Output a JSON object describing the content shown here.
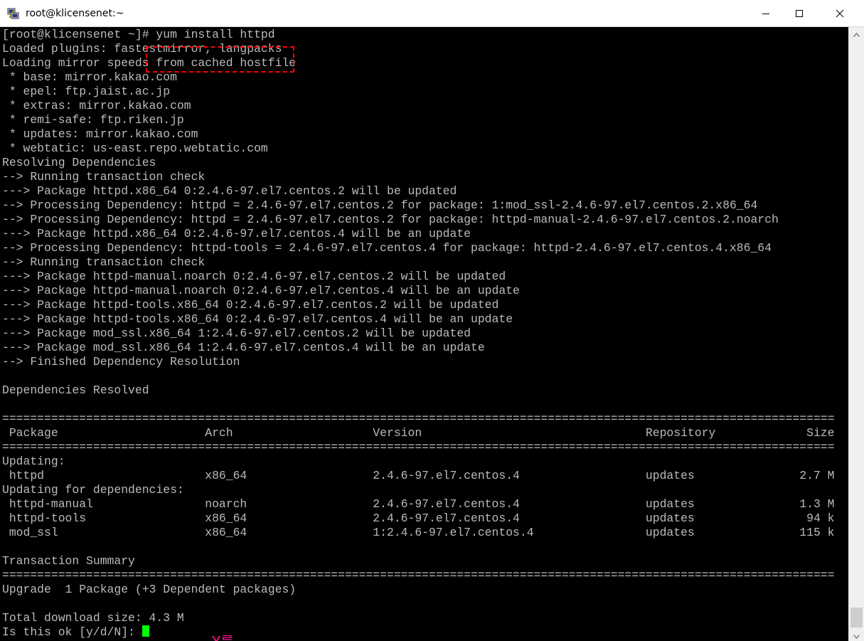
{
  "window": {
    "title": "root@klicensenet:~",
    "app_icon": "putty-icon",
    "controls": {
      "minimize": "minimize-icon",
      "maximize": "maximize-icon",
      "close": "close-icon"
    }
  },
  "terminal": {
    "foreground": "#bbbbbb",
    "background": "#000000",
    "cursor_color": "#00ff00",
    "lines": [
      "[root@klicensenet ~]# yum install httpd",
      "Loaded plugins: fastestmirror, langpacks",
      "Loading mirror speeds from cached hostfile",
      " * base: mirror.kakao.com",
      " * epel: ftp.jaist.ac.jp",
      " * extras: mirror.kakao.com",
      " * remi-safe: ftp.riken.jp",
      " * updates: mirror.kakao.com",
      " * webtatic: us-east.repo.webtatic.com",
      "Resolving Dependencies",
      "--> Running transaction check",
      "---> Package httpd.x86_64 0:2.4.6-97.el7.centos.2 will be updated",
      "--> Processing Dependency: httpd = 2.4.6-97.el7.centos.2 for package: 1:mod_ssl-2.4.6-97.el7.centos.2.x86_64",
      "--> Processing Dependency: httpd = 2.4.6-97.el7.centos.2 for package: httpd-manual-2.4.6-97.el7.centos.2.noarch",
      "---> Package httpd.x86_64 0:2.4.6-97.el7.centos.4 will be an update",
      "--> Processing Dependency: httpd-tools = 2.4.6-97.el7.centos.4 for package: httpd-2.4.6-97.el7.centos.4.x86_64",
      "--> Running transaction check",
      "---> Package httpd-manual.noarch 0:2.4.6-97.el7.centos.2 will be updated",
      "---> Package httpd-manual.noarch 0:2.4.6-97.el7.centos.4 will be an update",
      "---> Package httpd-tools.x86_64 0:2.4.6-97.el7.centos.2 will be updated",
      "---> Package httpd-tools.x86_64 0:2.4.6-97.el7.centos.4 will be an update",
      "---> Package mod_ssl.x86_64 1:2.4.6-97.el7.centos.2 will be updated",
      "---> Package mod_ssl.x86_64 1:2.4.6-97.el7.centos.4 will be an update",
      "--> Finished Dependency Resolution",
      "",
      "Dependencies Resolved",
      "",
      "=======================================================================================================================",
      " Package                     Arch                    Version                                Repository             Size",
      "=======================================================================================================================",
      "Updating:",
      " httpd                       x86_64                  2.4.6-97.el7.centos.4                  updates               2.7 M",
      "Updating for dependencies:",
      " httpd-manual                noarch                  2.4.6-97.el7.centos.4                  updates               1.3 M",
      " httpd-tools                 x86_64                  2.4.6-97.el7.centos.4                  updates                94 k",
      " mod_ssl                     x86_64                  1:2.4.6-97.el7.centos.4                updates               115 k",
      "",
      "Transaction Summary",
      "=======================================================================================================================",
      "Upgrade  1 Package (+3 Dependent packages)",
      "",
      "Total download size: 4.3 M",
      "Is this ok [y/d/N]: "
    ]
  },
  "annotation": {
    "text": "Y를",
    "color": "#ff1493",
    "highlight_color": "#ff0000"
  },
  "scrollbar": {
    "up_icon": "scroll-up-arrow-icon",
    "down_icon": "scroll-down-arrow-icon"
  }
}
